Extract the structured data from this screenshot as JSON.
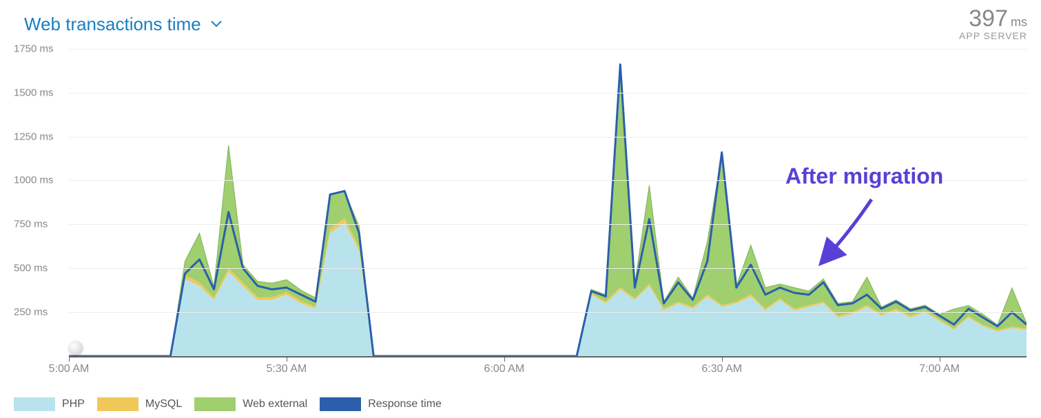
{
  "header": {
    "title": "Web transactions time",
    "value": "397",
    "unit": "ms",
    "metric_label": "APP SERVER"
  },
  "annotation": {
    "text": "After migration",
    "color": "#5a3fd6"
  },
  "legend": [
    {
      "name": "PHP",
      "color": "#b8e3ec"
    },
    {
      "name": "MySQL",
      "color": "#f0c85a"
    },
    {
      "name": "Web external",
      "color": "#9fcf6e"
    },
    {
      "name": "Response time",
      "color": "#2b5fab"
    }
  ],
  "chart_data": {
    "type": "area",
    "title": "Web transactions time",
    "xlabel": "",
    "ylabel": "ms",
    "ylim": [
      0,
      1800
    ],
    "x_ticks": [
      "5:00 AM",
      "5:30 AM",
      "6:00 AM",
      "6:30 AM",
      "7:00 AM"
    ],
    "y_ticks": [
      250,
      500,
      750,
      1000,
      1250,
      1500,
      1750
    ],
    "x_minutes": [
      0,
      2,
      4,
      6,
      8,
      10,
      12,
      14,
      16,
      18,
      20,
      22,
      24,
      26,
      28,
      30,
      32,
      34,
      36,
      38,
      40,
      42,
      44,
      46,
      48,
      50,
      52,
      54,
      56,
      58,
      60,
      62,
      64,
      66,
      68,
      70,
      72,
      74,
      76,
      78,
      80,
      82,
      84,
      86,
      88,
      90,
      92,
      94,
      96,
      98,
      100,
      102,
      104,
      106,
      108,
      110,
      112,
      114,
      116,
      118,
      120,
      122,
      124,
      126,
      128,
      130,
      132
    ],
    "series": [
      {
        "name": "PHP",
        "color": "#b8e3ec",
        "values": [
          0,
          0,
          0,
          0,
          0,
          0,
          0,
          0,
          440,
          400,
          320,
          480,
          400,
          320,
          320,
          350,
          300,
          270,
          700,
          760,
          600,
          0,
          0,
          0,
          0,
          0,
          0,
          0,
          0,
          0,
          0,
          0,
          0,
          0,
          0,
          0,
          350,
          300,
          380,
          320,
          400,
          260,
          300,
          270,
          340,
          280,
          300,
          340,
          260,
          320,
          260,
          280,
          300,
          220,
          240,
          280,
          230,
          260,
          220,
          250,
          200,
          150,
          220,
          170,
          140,
          160,
          150
        ]
      },
      {
        "name": "MySQL",
        "color": "#f0c85a",
        "values": [
          0,
          0,
          0,
          0,
          0,
          0,
          0,
          0,
          20,
          20,
          15,
          20,
          20,
          15,
          15,
          15,
          15,
          12,
          25,
          25,
          20,
          0,
          0,
          0,
          0,
          0,
          0,
          0,
          0,
          0,
          0,
          0,
          0,
          0,
          0,
          0,
          10,
          10,
          12,
          10,
          12,
          10,
          10,
          10,
          12,
          10,
          10,
          12,
          10,
          10,
          10,
          10,
          10,
          10,
          10,
          10,
          10,
          10,
          10,
          10,
          8,
          8,
          8,
          8,
          8,
          8,
          8
        ]
      },
      {
        "name": "Web external",
        "color": "#9fcf6e",
        "values": [
          0,
          0,
          0,
          0,
          0,
          0,
          0,
          0,
          80,
          280,
          60,
          700,
          100,
          90,
          80,
          70,
          60,
          50,
          200,
          150,
          120,
          0,
          0,
          0,
          0,
          0,
          0,
          0,
          0,
          0,
          0,
          0,
          0,
          0,
          0,
          0,
          20,
          40,
          1250,
          80,
          560,
          40,
          140,
          50,
          300,
          860,
          90,
          280,
          120,
          80,
          120,
          80,
          130,
          70,
          60,
          160,
          40,
          50,
          40,
          30,
          30,
          110,
          60,
          60,
          30,
          220,
          30
        ]
      }
    ],
    "response_time": {
      "name": "Response time",
      "color": "#2b5fab",
      "values": [
        0,
        0,
        0,
        0,
        0,
        0,
        0,
        0,
        470,
        550,
        380,
        820,
        500,
        400,
        380,
        390,
        350,
        310,
        920,
        940,
        700,
        0,
        0,
        0,
        0,
        0,
        0,
        0,
        0,
        0,
        0,
        0,
        0,
        0,
        0,
        0,
        370,
        340,
        1660,
        390,
        780,
        300,
        420,
        320,
        540,
        1160,
        390,
        520,
        350,
        390,
        360,
        350,
        420,
        290,
        300,
        350,
        270,
        310,
        260,
        280,
        230,
        180,
        270,
        220,
        170,
        250,
        180
      ]
    }
  }
}
